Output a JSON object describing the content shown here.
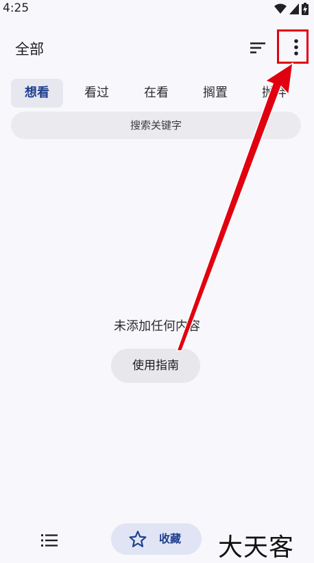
{
  "status_bar": {
    "time": "4:25"
  },
  "app_bar": {
    "title": "全部"
  },
  "tabs": [
    {
      "label": "想看",
      "selected": true
    },
    {
      "label": "看过",
      "selected": false
    },
    {
      "label": "在看",
      "selected": false
    },
    {
      "label": "搁置",
      "selected": false
    },
    {
      "label": "抛弃",
      "selected": false
    }
  ],
  "search": {
    "placeholder": "搜索关键字"
  },
  "empty_state": {
    "message": "未添加任何内容",
    "guide_button": "使用指南"
  },
  "bottom_nav": {
    "favorites_label": "收藏"
  },
  "watermark": "大天客",
  "colors": {
    "accent": "#1f3f8f",
    "annotation": "#e0000f"
  }
}
